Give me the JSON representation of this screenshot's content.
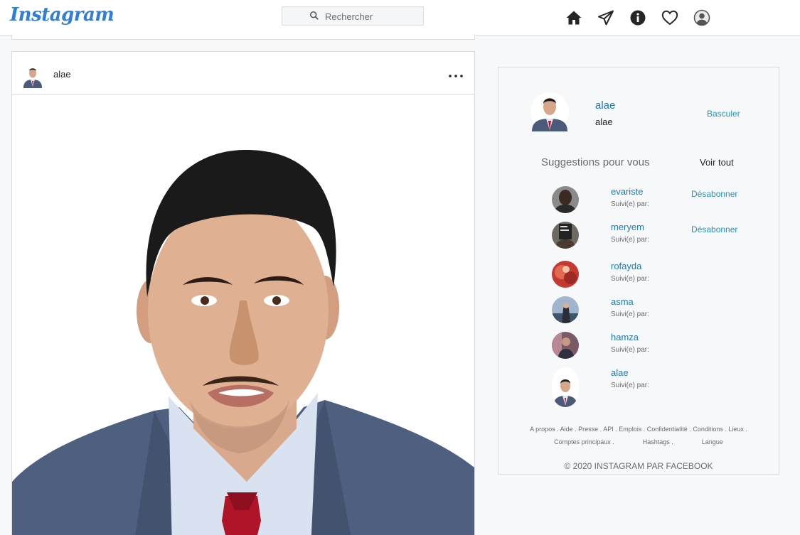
{
  "app": {
    "logo": "Instagram",
    "accent": "#1e7ab8",
    "link_color": "#1f95c2"
  },
  "search": {
    "placeholder": "Rechercher"
  },
  "nav_icons": [
    "home-icon",
    "send-icon",
    "info-icon",
    "heart-icon",
    "profile-icon"
  ],
  "post": {
    "username": "alae",
    "more_icon": "more-icon"
  },
  "sidebar": {
    "me": {
      "name": "alae",
      "sub": "alae",
      "switch_label": "Basculer"
    },
    "suggestions_title": "Suggestions pour vous",
    "see_all": "Voir tout",
    "suggestions": [
      {
        "name": "evariste",
        "sub": "Suivi(e) par:",
        "action": "Désabonner"
      },
      {
        "name": "meryem",
        "sub": "Suivi(e) par:",
        "action": "Désabonner"
      },
      {
        "name": "rofayda",
        "sub": "Suivi(e) par:",
        "action": ""
      },
      {
        "name": "asma",
        "sub": "Suivi(e) par:",
        "action": ""
      },
      {
        "name": "hamza",
        "sub": "Suivi(e) par:",
        "action": ""
      },
      {
        "name": "alae",
        "sub": "Suivi(e) par:",
        "action": ""
      }
    ],
    "footer_links": [
      "A propos .",
      "Aide .",
      "Presse .",
      "API .",
      "Emplois .",
      "Confidentialité .",
      "Conditions .",
      "Lieux .",
      "Comptes principaux .",
      "Hashtags .",
      "Langue"
    ],
    "copyright": "© 2020 INSTAGRAM PAR FACEBOOK"
  }
}
